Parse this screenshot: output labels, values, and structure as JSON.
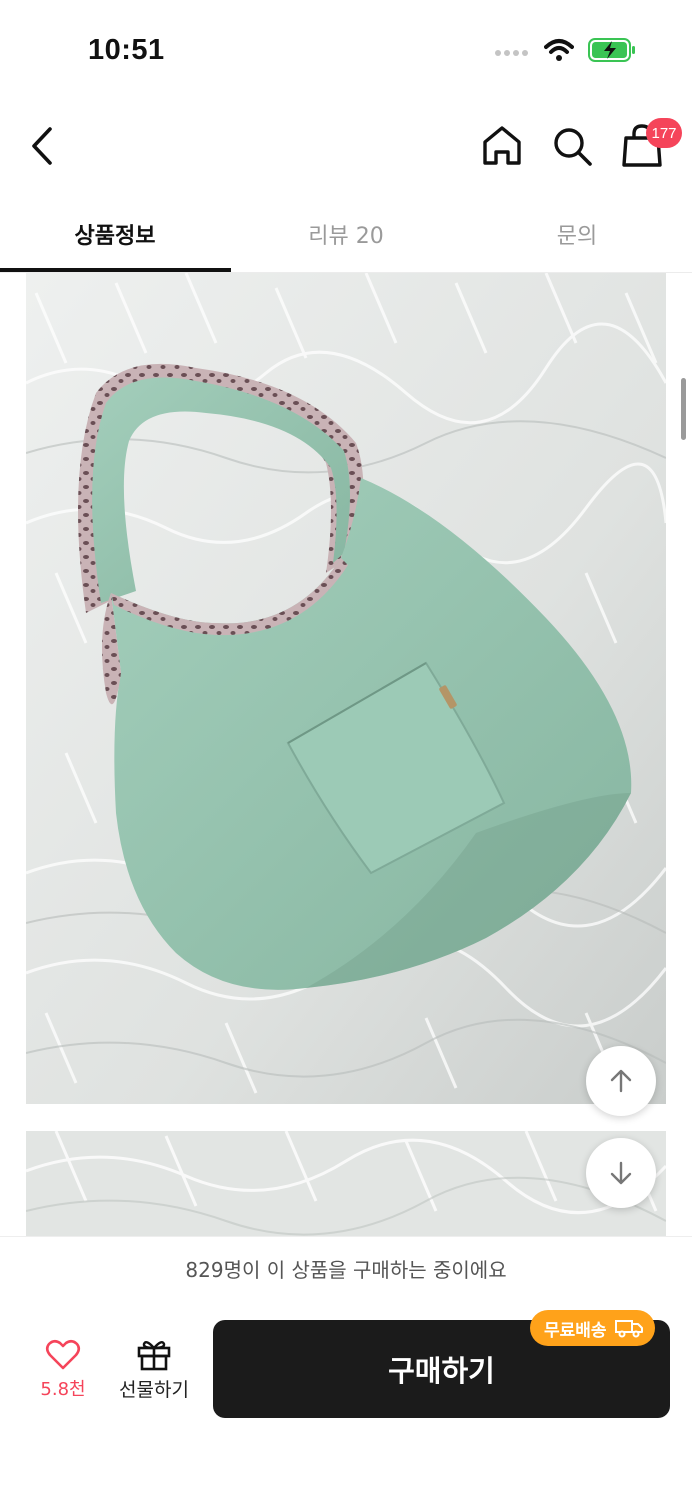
{
  "status_bar": {
    "time": "10:51"
  },
  "header": {
    "back_icon": "chevron-left-icon",
    "home_icon": "home-icon",
    "search_icon": "search-icon",
    "cart_icon": "shopping-bag-icon",
    "cart_badge": "177"
  },
  "tabs": [
    {
      "label": "상품정보",
      "active": true
    },
    {
      "label": "리뷰 20",
      "active": false
    },
    {
      "label": "문의",
      "active": false
    }
  ],
  "social_proof": "829명이 이 상품을 구매하는 중이에요",
  "bottom_bar": {
    "like_count": "5.8천",
    "gift_label": "선물하기",
    "buy_label": "구매하기",
    "free_shipping_badge": "무료배송"
  },
  "colors": {
    "accent_red": "#f5445a",
    "buy_button": "#1b1b1b",
    "free_shipping": "#ffa21a",
    "bag_green": "#93c2ad"
  }
}
